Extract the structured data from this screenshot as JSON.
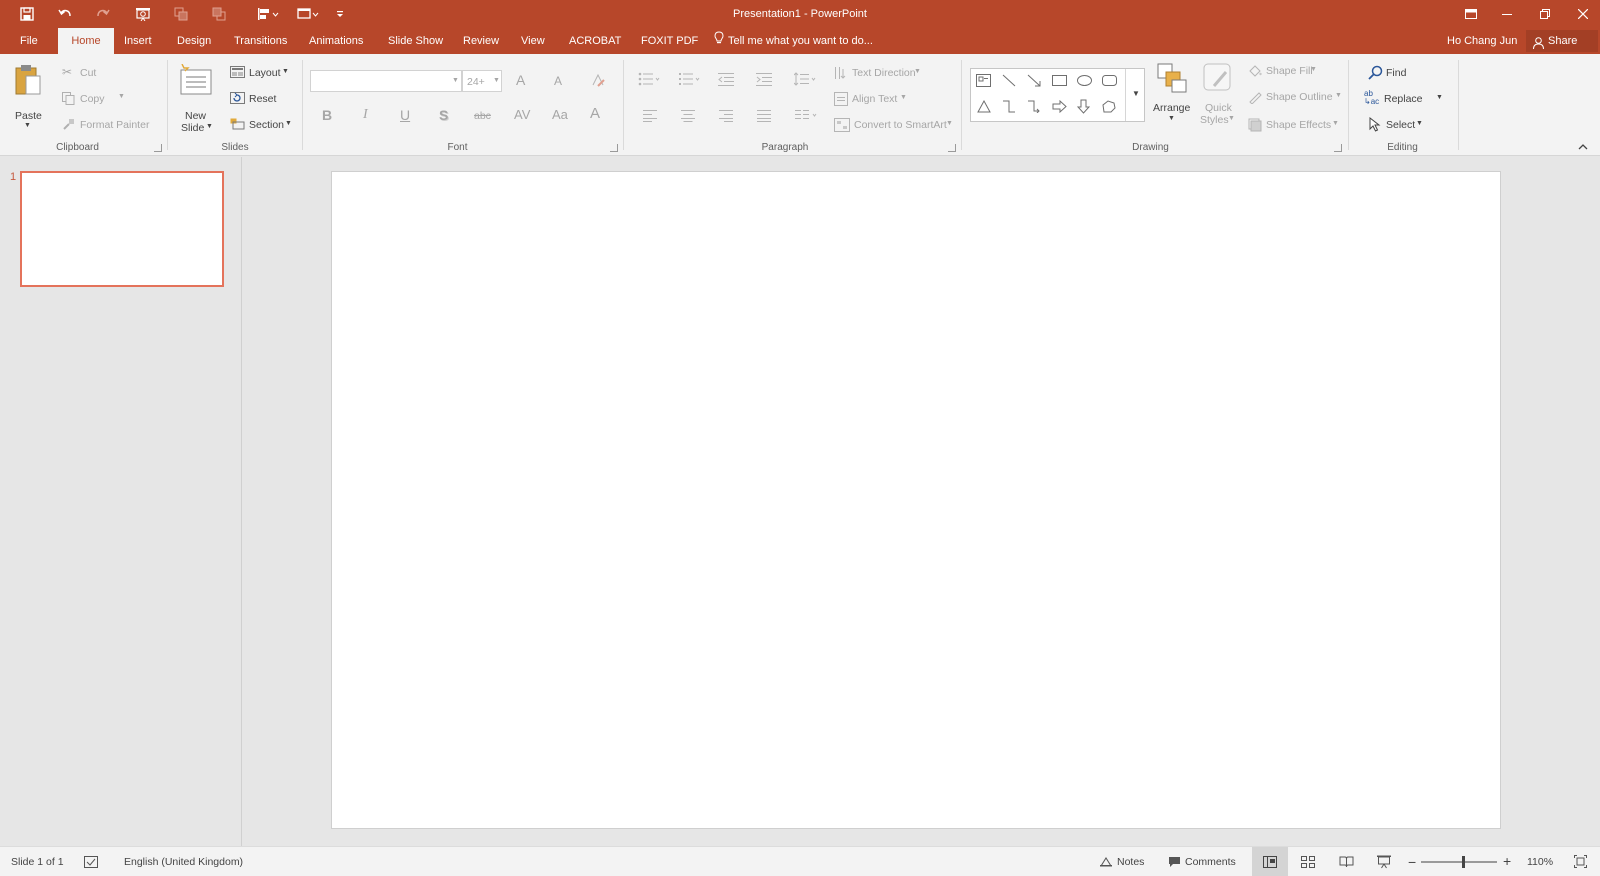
{
  "window": {
    "title": "Presentation1 - PowerPoint"
  },
  "tabs": {
    "file": "File",
    "home": "Home",
    "insert": "Insert",
    "design": "Design",
    "transitions": "Transitions",
    "animations": "Animations",
    "slideshow": "Slide Show",
    "review": "Review",
    "view": "View",
    "acrobat": "ACROBAT",
    "foxit": "FOXIT PDF",
    "tellme": "Tell me what you want to do..."
  },
  "account": {
    "user": "Ho Chang Jun",
    "share": "Share"
  },
  "clipboard": {
    "paste": "Paste",
    "cut": "Cut",
    "copy": "Copy",
    "format_painter": "Format Painter",
    "group": "Clipboard"
  },
  "slides_group": {
    "new_slide_1": "New",
    "new_slide_2": "Slide",
    "layout": "Layout",
    "reset": "Reset",
    "section": "Section",
    "group": "Slides"
  },
  "font": {
    "font_name": "",
    "font_size": "24+",
    "bold": "B",
    "italic": "I",
    "underline": "U",
    "shadow": "S",
    "strike": "abc",
    "spacing": "AV",
    "case": "Aa",
    "color": "A",
    "grow": "A",
    "shrink": "A",
    "group": "Font"
  },
  "paragraph": {
    "text_direction": "Text Direction",
    "align_text": "Align Text",
    "smartart": "Convert to SmartArt",
    "group": "Paragraph"
  },
  "drawing": {
    "arrange": "Arrange",
    "quick_styles_1": "Quick",
    "quick_styles_2": "Styles",
    "shape_fill": "Shape Fill",
    "shape_outline": "Shape Outline",
    "shape_effects": "Shape Effects",
    "group": "Drawing"
  },
  "editing": {
    "find": "Find",
    "replace": "Replace",
    "select": "Select",
    "group": "Editing"
  },
  "slide_pane": {
    "number": "1"
  },
  "status": {
    "slide_info": "Slide 1 of 1",
    "language": "English (United Kingdom)",
    "notes": "Notes",
    "comments": "Comments",
    "zoom": "110%",
    "zoom_level": 0.55
  },
  "colors": {
    "accent": "#b7472a",
    "thumb_border": "#e4735b"
  }
}
